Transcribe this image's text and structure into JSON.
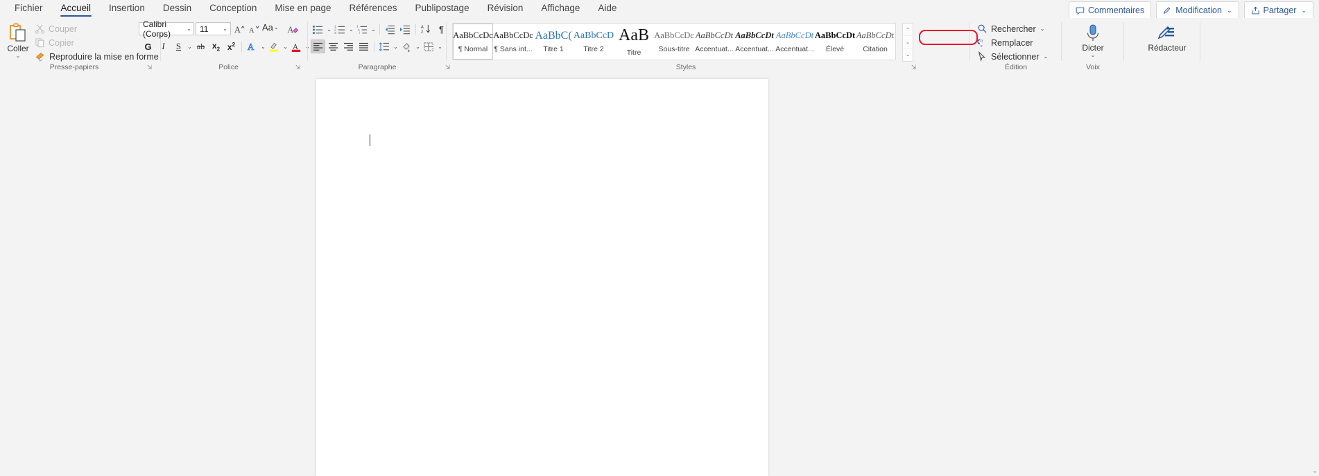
{
  "tabs": [
    {
      "label": "Fichier",
      "active": false
    },
    {
      "label": "Accueil",
      "active": true
    },
    {
      "label": "Insertion",
      "active": false
    },
    {
      "label": "Dessin",
      "active": false
    },
    {
      "label": "Conception",
      "active": false
    },
    {
      "label": "Mise en page",
      "active": false
    },
    {
      "label": "Références",
      "active": false
    },
    {
      "label": "Publipostage",
      "active": false
    },
    {
      "label": "Révision",
      "active": false
    },
    {
      "label": "Affichage",
      "active": false
    },
    {
      "label": "Aide",
      "active": false
    }
  ],
  "title_bar_buttons": {
    "comments": "Commentaires",
    "editing": "Modification",
    "share": "Partager",
    "chevron": "⌄"
  },
  "clipboard": {
    "group_label": "Presse-papiers",
    "paste": "Coller",
    "paste_chevron": "⌄",
    "cut": "Couper",
    "copy": "Copier",
    "format_painter": "Reproduire la mise en forme",
    "dialog_launcher": "⇲"
  },
  "font": {
    "group_label": "Police",
    "font_name": "Calibri (Corps)",
    "font_size": "11",
    "grow_font": "A",
    "shrink_font": "A",
    "change_case": "Aa",
    "clear_formatting": "A",
    "bold": "G",
    "italic": "I",
    "underline": "S",
    "strikethrough": "ab",
    "subscript": "x",
    "superscript": "x",
    "text_effects": "A",
    "highlight": "A",
    "font_color": "A",
    "dialog_launcher": "⇲",
    "chevron": "⌄"
  },
  "paragraph": {
    "group_label": "Paragraphe",
    "bullets": "bullet-list",
    "numbering": "numbered-list",
    "multilevel": "multilevel-list",
    "decrease_indent": "decrease-indent",
    "increase_indent": "increase-indent",
    "sort": "sort",
    "show_marks": "¶",
    "align_left": "align-left",
    "align_center": "align-center",
    "align_right": "align-right",
    "justify": "justify",
    "line_spacing": "line-spacing",
    "shading": "shading",
    "borders": "borders",
    "dialog_launcher": "⇲",
    "chevron": "⌄"
  },
  "styles": {
    "group_label": "Styles",
    "dialog_launcher": "⇲",
    "items": [
      {
        "preview": "AaBbCcDc",
        "name": "¶ Normal",
        "selected": true,
        "style": "normal"
      },
      {
        "preview": "AaBbCcDc",
        "name": "¶ Sans int...",
        "selected": false,
        "style": "nospace"
      },
      {
        "preview": "AaBbC(",
        "name": "Titre 1",
        "selected": false,
        "style": "h1"
      },
      {
        "preview": "AaBbCcD",
        "name": "Titre 2",
        "selected": false,
        "style": "h2"
      },
      {
        "preview": "AaB",
        "name": "Titre",
        "selected": false,
        "style": "title"
      },
      {
        "preview": "AaBbCcDc",
        "name": "Sous-titre",
        "selected": false,
        "style": "subtitle"
      },
      {
        "preview": "AaBbCcDt",
        "name": "Accentuat...",
        "selected": false,
        "style": "em"
      },
      {
        "preview": "AaBbCcDt",
        "name": "Accentuat...",
        "selected": false,
        "style": "strongem"
      },
      {
        "preview": "AaBbCcDt",
        "name": "Accentuat...",
        "selected": false,
        "style": "blueem"
      },
      {
        "preview": "AaBbCcDt",
        "name": "Élevé",
        "selected": false,
        "style": "strong"
      },
      {
        "preview": "AaBbCcDt",
        "name": "Citation",
        "selected": false,
        "style": "quote"
      }
    ],
    "scroll_up": "⌃",
    "scroll_down": "⌄",
    "more": "⌄"
  },
  "editing": {
    "group_label": "Édition",
    "find": "Rechercher",
    "replace": "Remplacer",
    "select": "Sélectionner",
    "chevron": "⌄"
  },
  "voice": {
    "group_label": "Voix",
    "dictate": "Dicter",
    "chevron": "⌄"
  },
  "editor": {
    "label": "Rédacteur"
  },
  "document": {
    "scroll_up_arrow": "⌃",
    "scroll_down_arrow": "⌄"
  },
  "annotation": {
    "target": "Remplacer",
    "color": "#e81123"
  }
}
